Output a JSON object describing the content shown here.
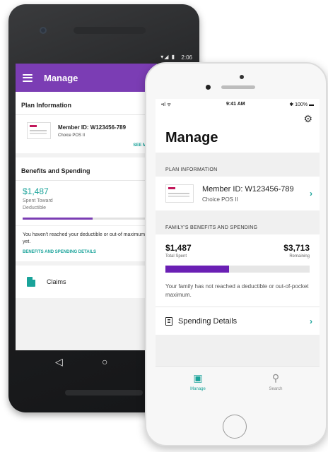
{
  "colors": {
    "android_purple": "#7b3db4",
    "teal": "#1aa39a",
    "ios_bar_purple": "#6a1fb4"
  },
  "android": {
    "status": {
      "time": "2:06",
      "icons": "signal-icon wifi-icon battery-icon"
    },
    "appbar": {
      "title": "Manage"
    },
    "plan": {
      "heading": "Plan Information",
      "member_id": "Member ID: W123456-789",
      "plan_name": "Choice POS II",
      "see_link": "SEE MEM"
    },
    "benefits": {
      "heading": "Benefits and Spending",
      "amount": "$1,487",
      "amount_label_1": "Spent Toward",
      "amount_label_2": "Deductible",
      "progress": 0.55,
      "note": "You haven't reached your deductible or out-of maximum yet.",
      "details_link": "BENEFITS AND SPENDING DETAILS"
    },
    "claims": {
      "label": "Claims"
    },
    "nav": {
      "back": "◁",
      "home": "○"
    }
  },
  "iphone": {
    "status": {
      "signal": "•ıl ᯤ",
      "time": "9:41 AM",
      "battery": "✱ 100% ▬"
    },
    "title": "Manage",
    "plan_section": "PLAN INFORMATION",
    "member_id": "Member ID: W123456-789",
    "plan_name": "Choice POS II",
    "benefits_section": "FAMILY'S BENEFITS AND SPENDING",
    "total_spent": "$1,487",
    "total_spent_label": "Total Spent",
    "remaining": "$3,713",
    "remaining_label": "Remaining",
    "progress": 0.44,
    "note": "Your family has not reached a deductible or out-of-pocket maximum.",
    "spending_details": "Spending Details",
    "tabs": [
      {
        "label": "Manage",
        "icon": "▣",
        "active": true
      },
      {
        "label": "Search",
        "icon": "⚲",
        "active": false
      }
    ]
  }
}
